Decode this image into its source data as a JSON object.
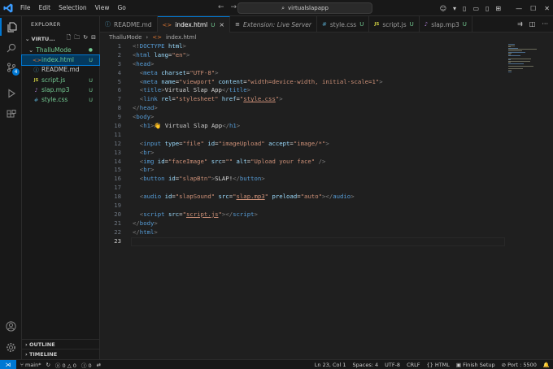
{
  "menu": [
    "File",
    "Edit",
    "Selection",
    "View",
    "Go"
  ],
  "search": {
    "text": "virtualslapapp"
  },
  "explorer": {
    "title": "EXPLORER",
    "project": "VIRTU...",
    "folder": {
      "name": "ThalluMode"
    },
    "files": [
      {
        "name": "index.html",
        "status": "U",
        "icon": "<>",
        "icon_color": "#e37933"
      },
      {
        "name": "README.md",
        "status": "",
        "icon": "ⓘ",
        "icon_color": "#519aba"
      },
      {
        "name": "script.js",
        "status": "U",
        "icon": "JS",
        "icon_color": "#cbcb41"
      },
      {
        "name": "slap.mp3",
        "status": "U",
        "icon": "♪",
        "icon_color": "#a074c4"
      },
      {
        "name": "style.css",
        "status": "U",
        "icon": "#",
        "icon_color": "#519aba"
      }
    ],
    "outline": "OUTLINE",
    "timeline": "TIMELINE"
  },
  "tabs": [
    {
      "label": "README.md",
      "status": "",
      "icon": "ⓘ",
      "icon_color": "#519aba"
    },
    {
      "label": "index.html",
      "status": "U",
      "icon": "<>",
      "icon_color": "#e37933"
    },
    {
      "label": "Extension: Live Server",
      "status": "",
      "icon": "≡",
      "icon_color": "#cccccc"
    },
    {
      "label": "style.css",
      "status": "U",
      "icon": "#",
      "icon_color": "#519aba"
    },
    {
      "label": "script.js",
      "status": "U",
      "icon": "JS",
      "icon_color": "#cbcb41"
    },
    {
      "label": "slap.mp3",
      "status": "U",
      "icon": "♪",
      "icon_color": "#a074c4"
    }
  ],
  "breadcrumb": {
    "folder": "ThalluMode",
    "file": "index.html"
  },
  "code_lines": [
    [
      [
        "t-brk",
        "<!"
      ],
      [
        "t-tag",
        "DOCTYPE"
      ],
      [
        "t-txt",
        " "
      ],
      [
        "t-attr",
        "html"
      ],
      [
        "t-brk",
        ">"
      ]
    ],
    [
      [
        "t-brk",
        "<"
      ],
      [
        "t-tag",
        "html"
      ],
      [
        "t-txt",
        " "
      ],
      [
        "t-attr",
        "lang"
      ],
      [
        "t-txt",
        "="
      ],
      [
        "t-str",
        "\"en\""
      ],
      [
        "t-brk",
        ">"
      ]
    ],
    [
      [
        "t-brk",
        "<"
      ],
      [
        "t-tag",
        "head"
      ],
      [
        "t-brk",
        ">"
      ]
    ],
    [
      [
        "t-txt",
        "  "
      ],
      [
        "t-brk",
        "<"
      ],
      [
        "t-tag",
        "meta"
      ],
      [
        "t-txt",
        " "
      ],
      [
        "t-attr",
        "charset"
      ],
      [
        "t-txt",
        "="
      ],
      [
        "t-str",
        "\"UTF-8\""
      ],
      [
        "t-brk",
        ">"
      ]
    ],
    [
      [
        "t-txt",
        "  "
      ],
      [
        "t-brk",
        "<"
      ],
      [
        "t-tag",
        "meta"
      ],
      [
        "t-txt",
        " "
      ],
      [
        "t-attr",
        "name"
      ],
      [
        "t-txt",
        "="
      ],
      [
        "t-str",
        "\"viewport\""
      ],
      [
        "t-txt",
        " "
      ],
      [
        "t-attr",
        "content"
      ],
      [
        "t-txt",
        "="
      ],
      [
        "t-str",
        "\"width=device-width, initial-scale=1\""
      ],
      [
        "t-brk",
        ">"
      ]
    ],
    [
      [
        "t-txt",
        "  "
      ],
      [
        "t-brk",
        "<"
      ],
      [
        "t-tag",
        "title"
      ],
      [
        "t-brk",
        ">"
      ],
      [
        "t-txt",
        "Virtual Slap App"
      ],
      [
        "t-brk",
        "</"
      ],
      [
        "t-tag",
        "title"
      ],
      [
        "t-brk",
        ">"
      ]
    ],
    [
      [
        "t-txt",
        "  "
      ],
      [
        "t-brk",
        "<"
      ],
      [
        "t-tag",
        "link"
      ],
      [
        "t-txt",
        " "
      ],
      [
        "t-attr",
        "rel"
      ],
      [
        "t-txt",
        "="
      ],
      [
        "t-str",
        "\"stylesheet\""
      ],
      [
        "t-txt",
        " "
      ],
      [
        "t-attr",
        "href"
      ],
      [
        "t-txt",
        "="
      ],
      [
        "t-str",
        "\""
      ],
      [
        "t-link",
        "style.css"
      ],
      [
        "t-str",
        "\""
      ],
      [
        "t-brk",
        ">"
      ]
    ],
    [
      [
        "t-brk",
        "</"
      ],
      [
        "t-tag",
        "head"
      ],
      [
        "t-brk",
        ">"
      ]
    ],
    [
      [
        "t-brk",
        "<"
      ],
      [
        "t-tag",
        "body"
      ],
      [
        "t-brk",
        ">"
      ]
    ],
    [
      [
        "t-txt",
        "  "
      ],
      [
        "t-brk",
        "<"
      ],
      [
        "t-tag",
        "h1"
      ],
      [
        "t-brk",
        ">"
      ],
      [
        "t-txt",
        "👋 Virtual Slap App"
      ],
      [
        "t-brk",
        "</"
      ],
      [
        "t-tag",
        "h1"
      ],
      [
        "t-brk",
        ">"
      ]
    ],
    [],
    [
      [
        "t-txt",
        "  "
      ],
      [
        "t-brk",
        "<"
      ],
      [
        "t-tag",
        "input"
      ],
      [
        "t-txt",
        " "
      ],
      [
        "t-attr",
        "type"
      ],
      [
        "t-txt",
        "="
      ],
      [
        "t-str",
        "\"file\""
      ],
      [
        "t-txt",
        " "
      ],
      [
        "t-attr",
        "id"
      ],
      [
        "t-txt",
        "="
      ],
      [
        "t-str",
        "\"imageUpload\""
      ],
      [
        "t-txt",
        " "
      ],
      [
        "t-attr",
        "accept"
      ],
      [
        "t-txt",
        "="
      ],
      [
        "t-str",
        "\"image/*\""
      ],
      [
        "t-brk",
        ">"
      ]
    ],
    [
      [
        "t-txt",
        "  "
      ],
      [
        "t-brk",
        "<"
      ],
      [
        "t-tag",
        "br"
      ],
      [
        "t-brk",
        ">"
      ]
    ],
    [
      [
        "t-txt",
        "  "
      ],
      [
        "t-brk",
        "<"
      ],
      [
        "t-tag",
        "img"
      ],
      [
        "t-txt",
        " "
      ],
      [
        "t-attr",
        "id"
      ],
      [
        "t-txt",
        "="
      ],
      [
        "t-str",
        "\"faceImage\""
      ],
      [
        "t-txt",
        " "
      ],
      [
        "t-attr",
        "src"
      ],
      [
        "t-txt",
        "="
      ],
      [
        "t-str",
        "\"\""
      ],
      [
        "t-txt",
        " "
      ],
      [
        "t-attr",
        "alt"
      ],
      [
        "t-txt",
        "="
      ],
      [
        "t-str",
        "\"Upload your face\""
      ],
      [
        "t-txt",
        " "
      ],
      [
        "t-brk",
        "/>"
      ]
    ],
    [
      [
        "t-txt",
        "  "
      ],
      [
        "t-brk",
        "<"
      ],
      [
        "t-tag",
        "br"
      ],
      [
        "t-brk",
        ">"
      ]
    ],
    [
      [
        "t-txt",
        "  "
      ],
      [
        "t-brk",
        "<"
      ],
      [
        "t-tag",
        "button"
      ],
      [
        "t-txt",
        " "
      ],
      [
        "t-attr",
        "id"
      ],
      [
        "t-txt",
        "="
      ],
      [
        "t-str",
        "\"slapBtn\""
      ],
      [
        "t-brk",
        ">"
      ],
      [
        "t-txt",
        "SLAP!"
      ],
      [
        "t-brk",
        "</"
      ],
      [
        "t-tag",
        "button"
      ],
      [
        "t-brk",
        ">"
      ]
    ],
    [],
    [
      [
        "t-txt",
        "  "
      ],
      [
        "t-brk",
        "<"
      ],
      [
        "t-tag",
        "audio"
      ],
      [
        "t-txt",
        " "
      ],
      [
        "t-attr",
        "id"
      ],
      [
        "t-txt",
        "="
      ],
      [
        "t-str",
        "\"slapSound\""
      ],
      [
        "t-txt",
        " "
      ],
      [
        "t-attr",
        "src"
      ],
      [
        "t-txt",
        "="
      ],
      [
        "t-str",
        "\""
      ],
      [
        "t-link",
        "slap.mp3"
      ],
      [
        "t-str",
        "\""
      ],
      [
        "t-txt",
        " "
      ],
      [
        "t-attr",
        "preload"
      ],
      [
        "t-txt",
        "="
      ],
      [
        "t-str",
        "\"auto\""
      ],
      [
        "t-brk",
        ">"
      ],
      [
        "t-brk",
        "</"
      ],
      [
        "t-tag",
        "audio"
      ],
      [
        "t-brk",
        ">"
      ]
    ],
    [],
    [
      [
        "t-txt",
        "  "
      ],
      [
        "t-brk",
        "<"
      ],
      [
        "t-tag",
        "script"
      ],
      [
        "t-txt",
        " "
      ],
      [
        "t-attr",
        "src"
      ],
      [
        "t-txt",
        "="
      ],
      [
        "t-str",
        "\""
      ],
      [
        "t-link",
        "script.js"
      ],
      [
        "t-str",
        "\""
      ],
      [
        "t-brk",
        ">"
      ],
      [
        "t-brk",
        "</"
      ],
      [
        "t-tag",
        "script"
      ],
      [
        "t-brk",
        ">"
      ]
    ],
    [
      [
        "t-brk",
        "</"
      ],
      [
        "t-tag",
        "body"
      ],
      [
        "t-brk",
        ">"
      ]
    ],
    [
      [
        "t-brk",
        "</"
      ],
      [
        "t-tag",
        "html"
      ],
      [
        "t-brk",
        ">"
      ]
    ],
    []
  ],
  "current_line": 23,
  "status": {
    "branch": "main*",
    "errors": "0",
    "warnings": "0",
    "info": "0",
    "position": "Ln 23, Col 1",
    "spaces": "Spaces: 4",
    "encoding": "UTF-8",
    "eol": "CRLF",
    "language": "HTML",
    "finish_setup": "Finish Setup",
    "port": "Port : 5500"
  },
  "colors": {
    "accent": "#0078d4",
    "untracked": "#73c991"
  }
}
